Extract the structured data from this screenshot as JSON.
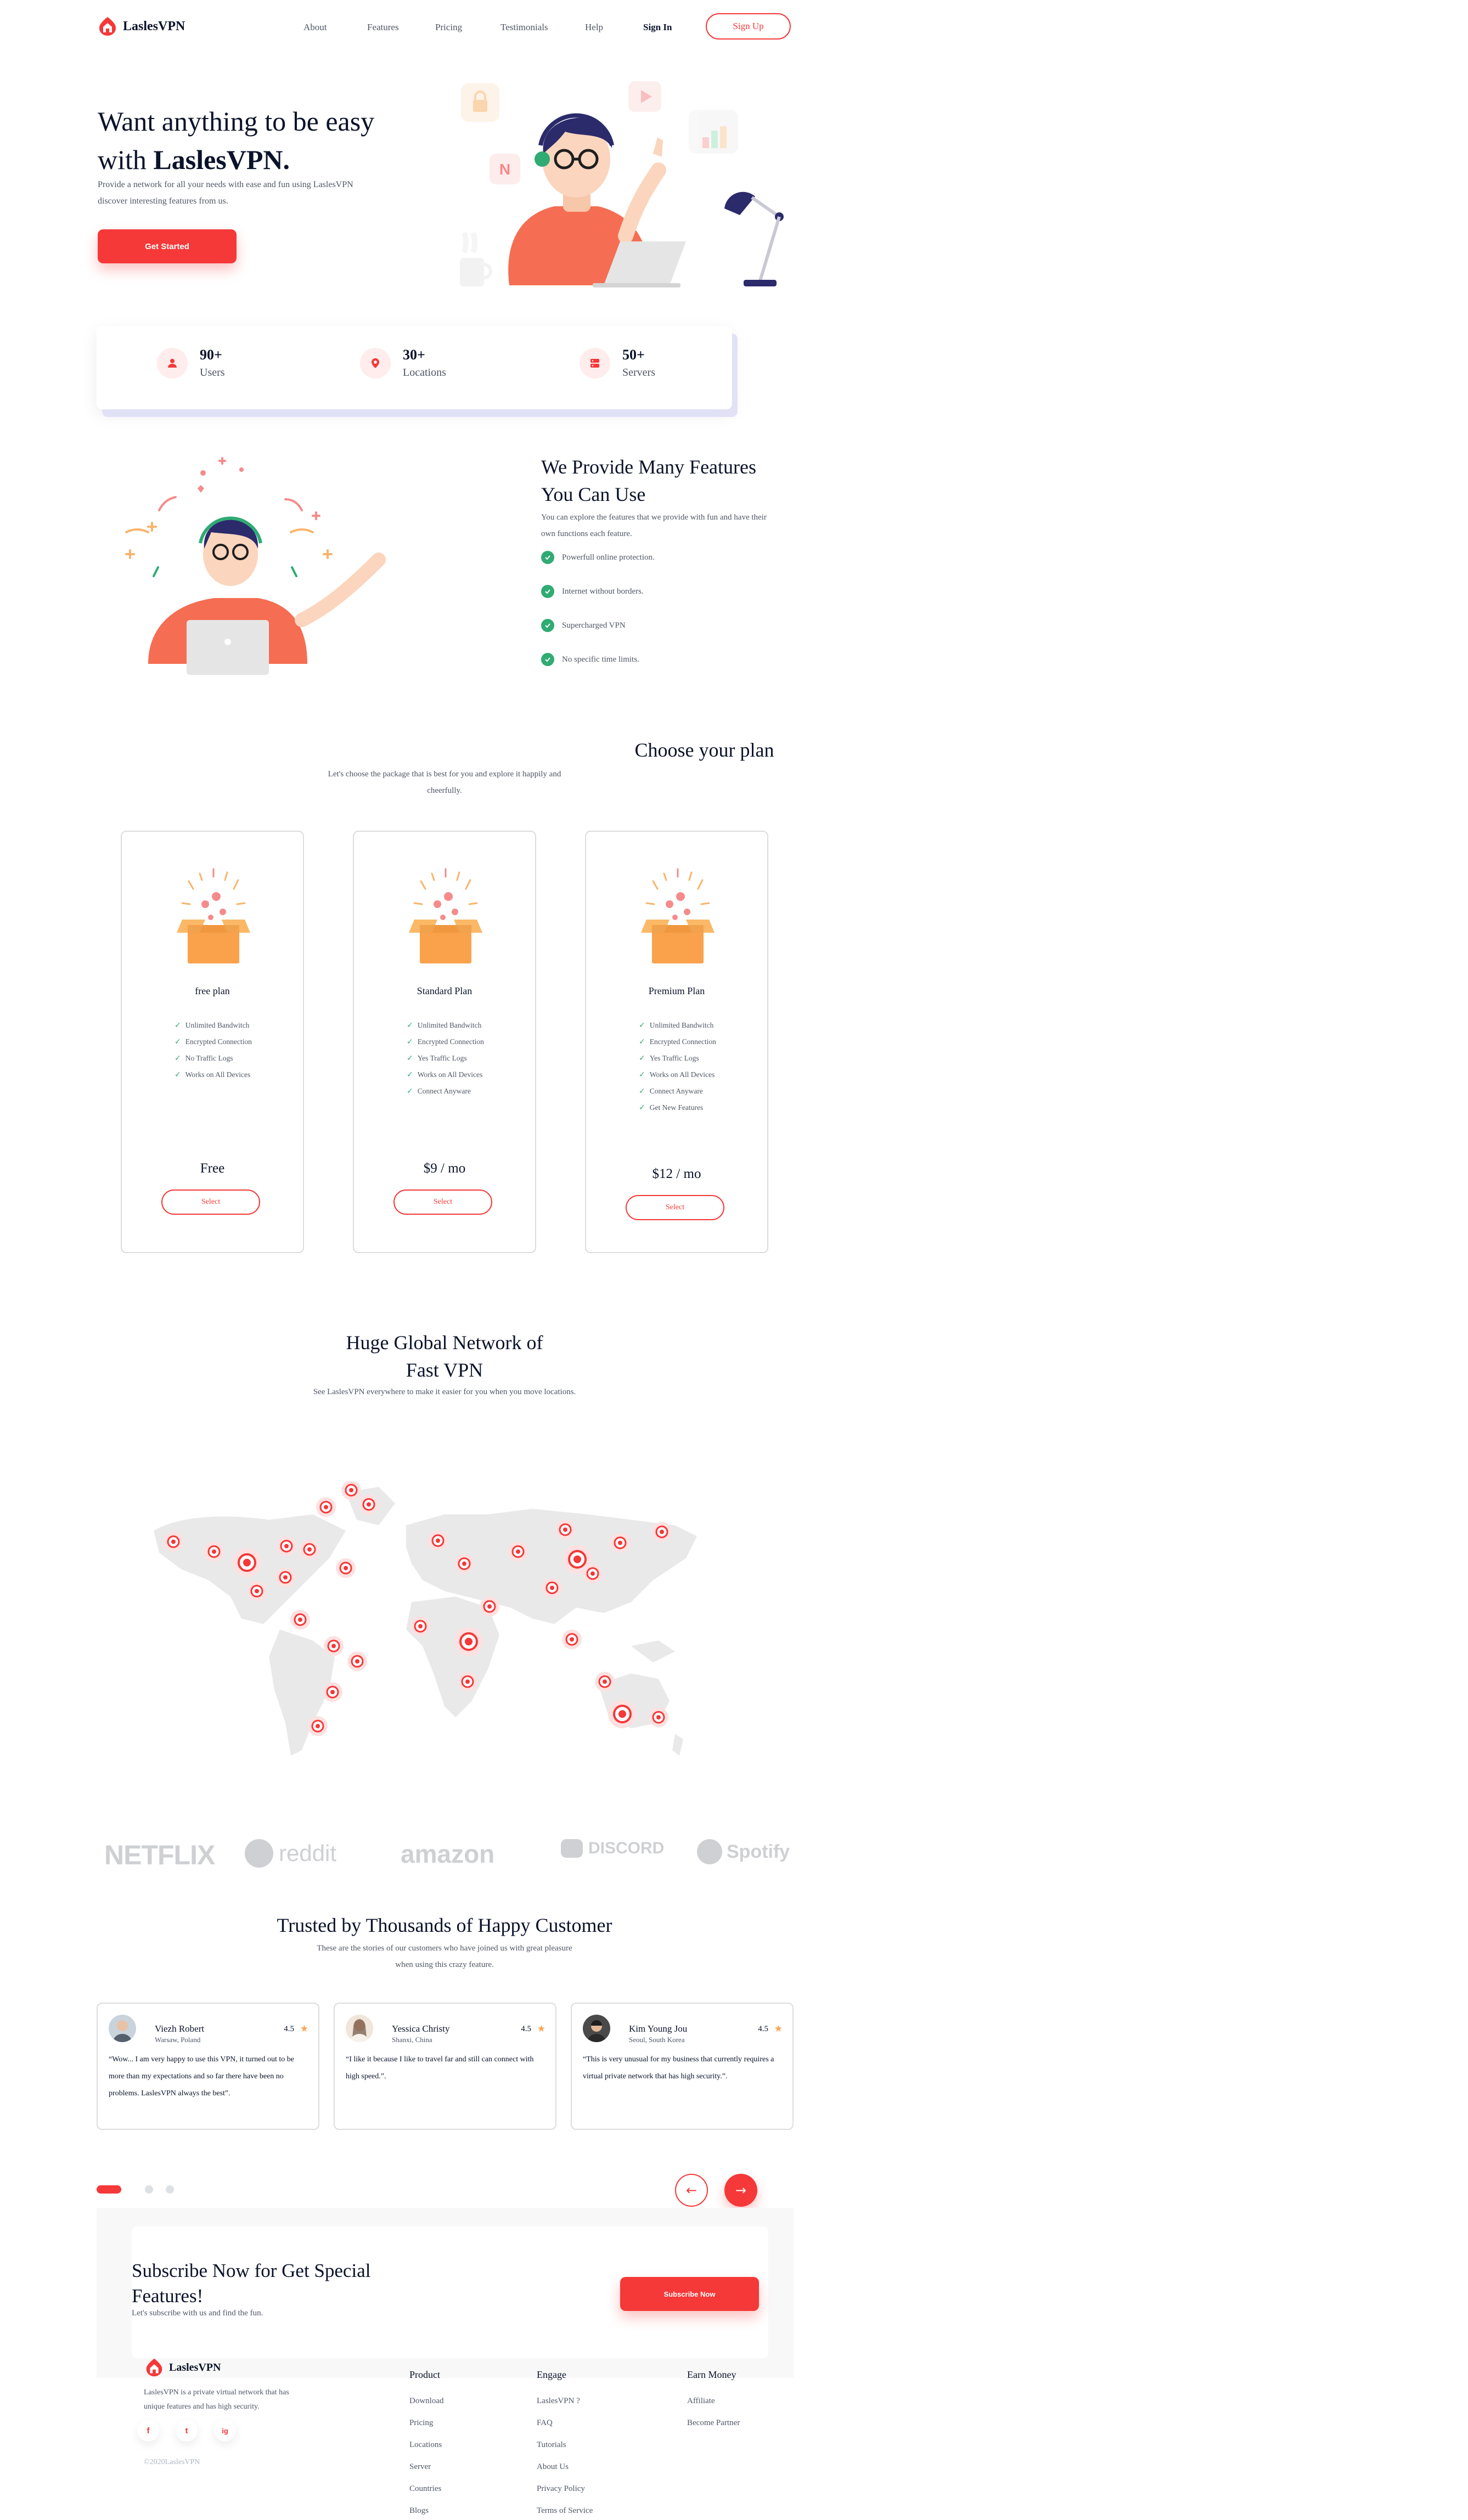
{
  "nav": {
    "brand": "LaslesVPN",
    "links": [
      "About",
      "Features",
      "Pricing",
      "Testimonials",
      "Help"
    ],
    "signin": "Sign In",
    "signup": "Sign Up"
  },
  "hero": {
    "title_line1": "Want anything to be easy",
    "title_line2_prefix": "with ",
    "title_line2_bold": "LaslesVPN.",
    "subtitle": "Provide a network for all your needs with ease and fun using LaslesVPN discover interesting features from us.",
    "cta": "Get Started"
  },
  "stats": [
    {
      "number": "90+",
      "label": "Users",
      "icon": "user-icon"
    },
    {
      "number": "30+",
      "label": "Locations",
      "icon": "location-pin-icon"
    },
    {
      "number": "50+",
      "label": "Servers",
      "icon": "server-icon"
    }
  ],
  "features": {
    "title": "We Provide Many Features You Can Use",
    "subtitle": "You can explore the features that we provide with fun and have their own functions each feature.",
    "items": [
      "Powerfull online protection.",
      "Internet without borders.",
      "Supercharged VPN",
      "No specific time limits."
    ]
  },
  "plans": {
    "title": "Choose your plan",
    "subtitle": "Let's choose the package that is best for you and explore it happily and cheerfully.",
    "items": [
      {
        "name": "free plan",
        "features": [
          "Unlimited Bandwitch",
          "Encrypted Connection",
          "No Traffic Logs",
          "Works on All Devices"
        ],
        "price": "Free",
        "button": "Select"
      },
      {
        "name": "Standard Plan",
        "features": [
          "Unlimited Bandwitch",
          "Encrypted Connection",
          "Yes Traffic Logs",
          "Works on All Devices",
          "Connect Anyware"
        ],
        "price": "$9 / mo",
        "button": "Select"
      },
      {
        "name": "Premium Plan",
        "features": [
          "Unlimited Bandwitch",
          "Encrypted Connection",
          "Yes Traffic Logs",
          "Works on All Devices",
          "Connect Anyware",
          "Get New Features"
        ],
        "price": "$12 / mo",
        "button": "Select"
      }
    ]
  },
  "network": {
    "title": "Huge Global Network of Fast VPN",
    "subtitle": "See LaslesVPN everywhere to make it easier for you when you move locations."
  },
  "brands": [
    "NETFLIX",
    "reddit",
    "amazon",
    "DISCORD",
    "Spotify"
  ],
  "testimonials": {
    "title": "Trusted by Thousands of Happy Customer",
    "subtitle": "These are the stories of our customers who have joined us with great pleasure when using this crazy feature.",
    "items": [
      {
        "name": "Viezh Robert",
        "location": "Warsaw, Poland",
        "rating": "4.5",
        "quote": "“Wow... I am very happy to use this VPN, it turned out to be more than my expectations and so far there have been no problems. LaslesVPN always the best”."
      },
      {
        "name": "Yessica Christy",
        "location": "Shanxi, China",
        "rating": "4.5",
        "quote": "“I like it because I like to travel far and still can connect with high speed.”."
      },
      {
        "name": "Kim Young Jou",
        "location": "Seoul, South Korea",
        "rating": "4.5",
        "quote": "“This is very unusual for my business that currently requires a virtual private network that has high security.”."
      }
    ]
  },
  "subscribe": {
    "title": "Subscribe Now for Get Special Features!",
    "subtitle": "Let's subscribe with us and find the fun.",
    "button": "Subscribe Now"
  },
  "footer": {
    "brand": "LaslesVPN",
    "description": "LaslesVPN is a private virtual network that has unique features and has high security.",
    "socials": [
      "f",
      "t",
      "ig"
    ],
    "copyright": "©2020LaslesVPN",
    "columns": [
      {
        "heading": "Product",
        "links": [
          "Download",
          "Pricing",
          "Locations",
          "Server",
          "Countries",
          "Blogs"
        ]
      },
      {
        "heading": "Engage",
        "links": [
          "LaslesVPN ?",
          "FAQ",
          "Tutorials",
          "About Us",
          "Privacy Policy",
          "Terms of Service"
        ]
      },
      {
        "heading": "Earn Money",
        "links": [
          "Affiliate",
          "Become Partner"
        ]
      }
    ]
  },
  "colors": {
    "accent": "#F53838",
    "text": "#0B132A",
    "muted": "#4F5665",
    "check": "#2FAB73"
  }
}
